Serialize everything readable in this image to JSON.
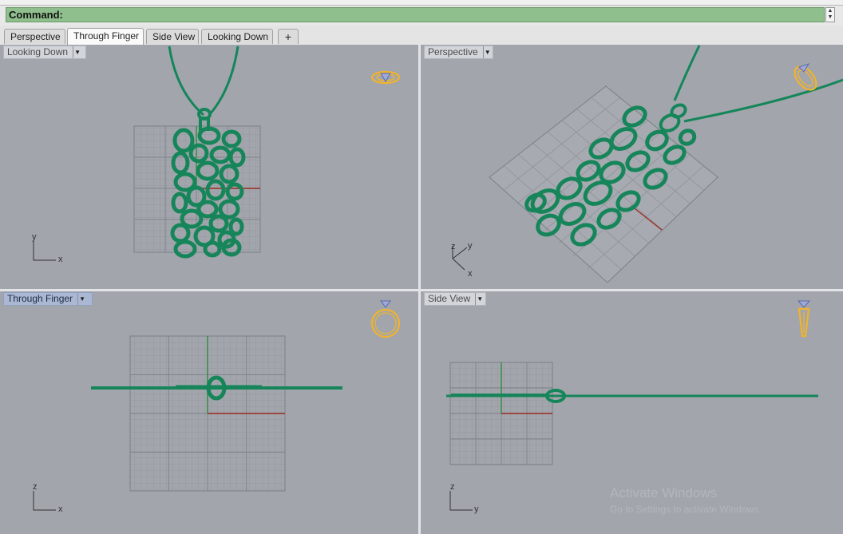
{
  "command": {
    "label": "Command:"
  },
  "tabs": [
    {
      "label": "Perspective"
    },
    {
      "label": "Through Finger"
    },
    {
      "label": "Side View"
    },
    {
      "label": "Looking Down"
    },
    {
      "label": "+"
    }
  ],
  "viewports": {
    "top_left": {
      "title": "Looking Down",
      "axis_v": "y",
      "axis_h": "x",
      "gizmo": "ring-top-icon"
    },
    "top_right": {
      "title": "Perspective",
      "axis_a": "z",
      "axis_b": "y",
      "axis_c": "x",
      "gizmo": "ring-perspective-icon"
    },
    "bottom_left": {
      "title": "Through Finger",
      "axis_v": "z",
      "axis_h": "x",
      "gizmo": "ring-front-icon",
      "active": true
    },
    "bottom_right": {
      "title": "Side View",
      "axis_v": "z",
      "axis_h": "y",
      "gizmo": "ring-side-icon"
    }
  },
  "watermark": {
    "line1": "Activate Windows",
    "line2": "Go to Settings to activate Windows."
  },
  "colors": {
    "model_green": "#16855a",
    "gizmo_gold": "#f2b32a",
    "viewport_bg": "#a2a6ac",
    "command_bg": "#8fbf8d",
    "x_axis_red": "#9b2a22",
    "y_axis_green": "#2e8b3e",
    "active_title_bg": "#aab8d3"
  }
}
